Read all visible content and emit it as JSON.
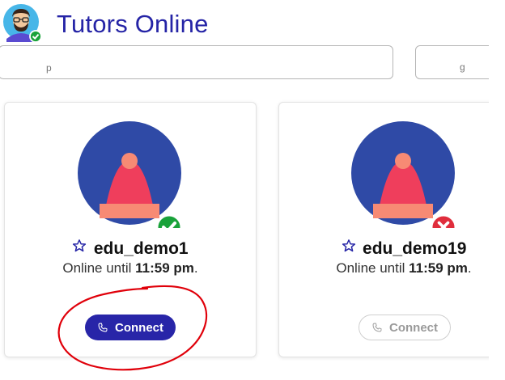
{
  "header": {
    "title": "Tutors Online"
  },
  "filters": {
    "search_hint": "p",
    "select_hint": "g"
  },
  "tutors": [
    {
      "name": "edu_demo1",
      "status_prefix": "Online until",
      "status_time": "11:59 pm",
      "status_suffix": ".",
      "available": true,
      "connect_label": "Connect"
    },
    {
      "name": "edu_demo19",
      "status_prefix": "Online until",
      "status_time": "11:59 pm",
      "status_suffix": ".",
      "available": false,
      "connect_label": "Connect"
    }
  ],
  "colors": {
    "accent": "#2524a6",
    "avatar_bg": "#2f4aa6",
    "hat": "#ef3e5c",
    "hat_band": "#f78a74",
    "online": "#19a23a",
    "offline": "#e02d3c",
    "annotation": "#e0000a"
  },
  "icons": {
    "user_avatar": "user-avatar",
    "favorite": "star-outline-icon",
    "connect": "phone-icon",
    "online_badge": "check-badge-icon",
    "offline_badge": "x-badge-icon"
  }
}
